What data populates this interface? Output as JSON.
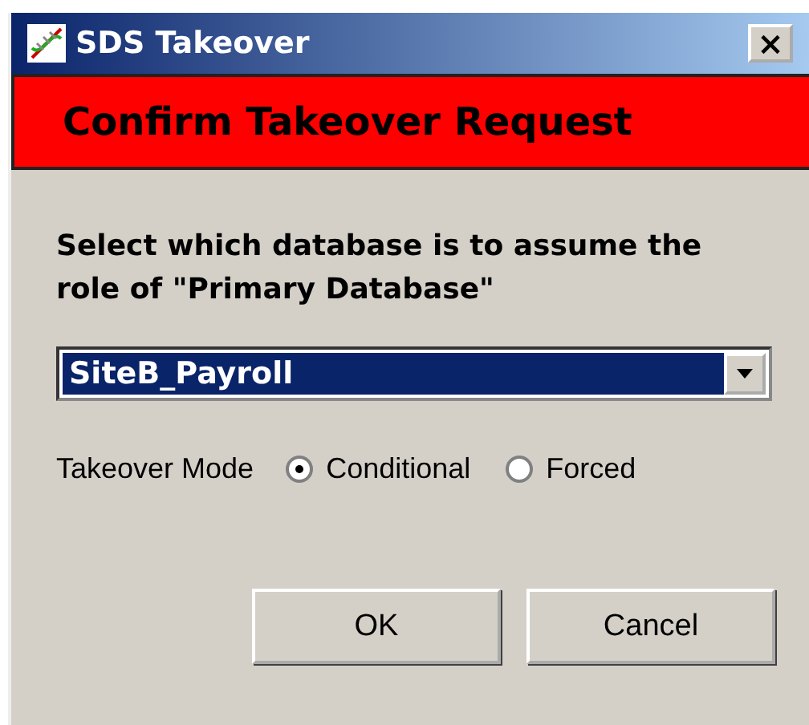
{
  "window": {
    "title": "SDS Takeover",
    "close": "×"
  },
  "banner": "Confirm Takeover Request",
  "prompt": "Select which database is to assume the role of \"Primary Database\"",
  "database": {
    "value": "SiteB_Payroll"
  },
  "mode": {
    "label": "Takeover Mode",
    "options": [
      {
        "label": "Conditional",
        "selected": true
      },
      {
        "label": "Forced",
        "selected": false
      }
    ]
  },
  "buttons": [
    "OK",
    "Cancel"
  ]
}
